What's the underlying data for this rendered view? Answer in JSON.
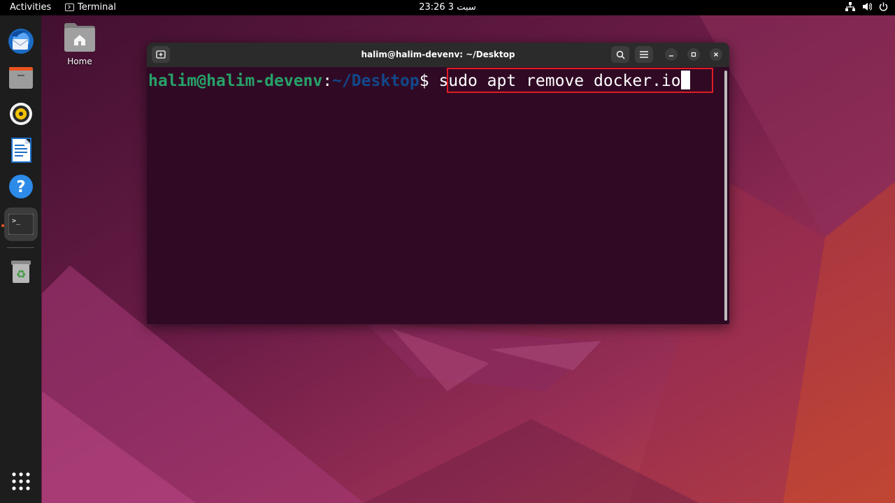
{
  "topbar": {
    "activities_label": "Activities",
    "app_name": "Terminal",
    "clock": "23:26  3 سبت"
  },
  "dock": {
    "items": [
      "thunderbird",
      "files",
      "rhythmbox",
      "libreoffice-writer",
      "help",
      "terminal",
      "trash",
      "show-applications"
    ],
    "active_item": "terminal"
  },
  "desktop": {
    "home_label": "Home"
  },
  "terminal": {
    "title": "halim@halim-devenv: ~/Desktop",
    "prompt_user": "halim@halim-devenv",
    "prompt_colon": ":",
    "prompt_path": "~/Desktop",
    "prompt_symbol": "$",
    "command": " sudo apt remove docker.io"
  },
  "colors": {
    "terminal_bg": "#300a24",
    "prompt_user": "#26a269",
    "prompt_path": "#12488b",
    "highlight_box": "#e01b24",
    "accent": "#e95420"
  }
}
